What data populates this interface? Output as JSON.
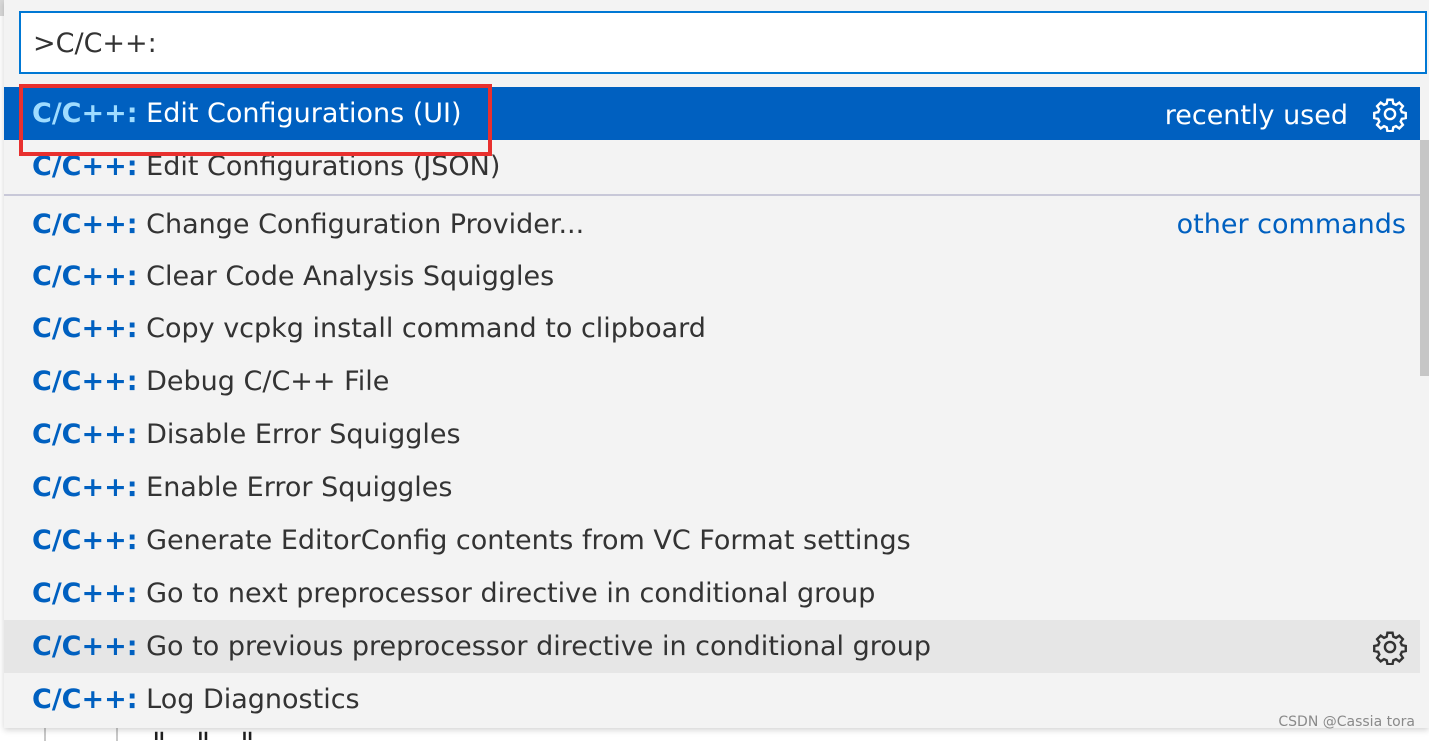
{
  "search": {
    "value": ">C/C++:"
  },
  "items": [
    {
      "prefix": "C/C++:",
      "text": " Edit Configurations (UI)",
      "tag": "recently used",
      "state": "selected"
    },
    {
      "prefix": "C/C++:",
      "text": " Edit Configurations (JSON)"
    },
    {
      "prefix": "C/C++:",
      "text": " Change Configuration Provider...",
      "tag": "other commands"
    },
    {
      "prefix": "C/C++:",
      "text": " Clear Code Analysis Squiggles"
    },
    {
      "prefix": "C/C++:",
      "text": " Copy vcpkg install command to clipboard"
    },
    {
      "prefix": "C/C++:",
      "text": " Debug C/C++ File"
    },
    {
      "prefix": "C/C++:",
      "text": " Disable Error Squiggles"
    },
    {
      "prefix": "C/C++:",
      "text": " Enable Error Squiggles"
    },
    {
      "prefix": "C/C++:",
      "text": " Generate EditorConfig contents from VC Format settings"
    },
    {
      "prefix": "C/C++:",
      "text": " Go to next preprocessor directive in conditional group"
    },
    {
      "prefix": "C/C++:",
      "text": " Go to previous preprocessor directive in conditional group",
      "state": "hovered"
    },
    {
      "prefix": "C/C++:",
      "text": " Log Diagnostics"
    }
  ],
  "icons": {
    "gear": "gear-icon"
  },
  "colors": {
    "accent": "#0060c0",
    "selected_bg": "#0060c0",
    "focus_border": "#0078d4",
    "annotation_red": "#e8302e"
  },
  "watermark": "CSDN @Cassia tora",
  "editor_ghost": "\"         \"     \""
}
